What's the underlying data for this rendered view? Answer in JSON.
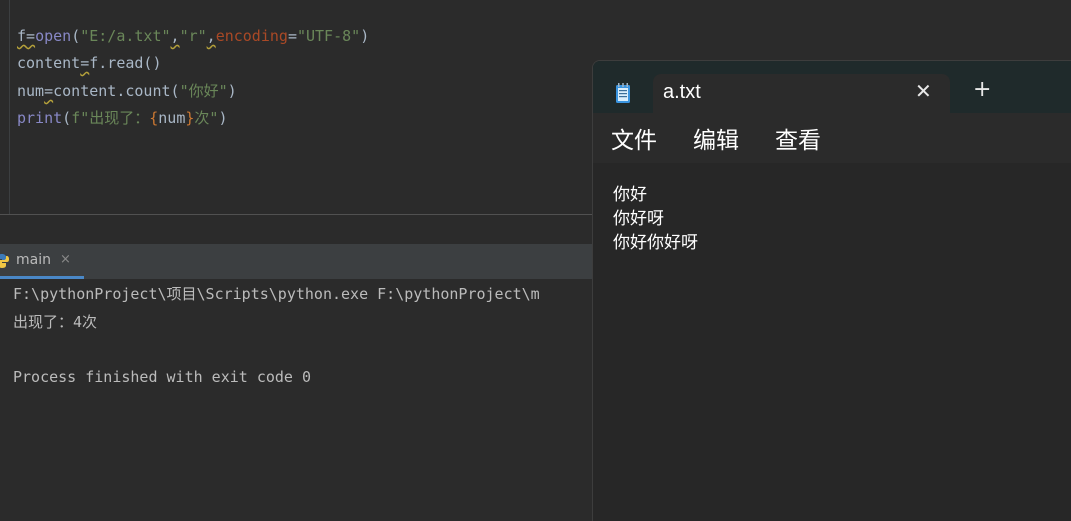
{
  "editor": {
    "lines": [
      {
        "p1": "f",
        "p2": "=",
        "p3": "open",
        "p4": "(",
        "p5": "\"E:/a.txt\"",
        "p6": ",",
        "p7": "\"r\"",
        "p8": ",",
        "p9": "encoding",
        "p10": "=",
        "p11": "\"UTF-8\"",
        "p12": ")"
      },
      {
        "p1": "content",
        "p2": "=",
        "p3": "f.read()"
      },
      {
        "p1": "num",
        "p2": "=",
        "p3": "content.count(",
        "p4": "\"你好\"",
        "p5": ")"
      },
      {
        "p1": "print",
        "p2": "(",
        "p3": "f\"出现了：",
        "p4": "{",
        "p5": "num",
        "p6": "}",
        "p7": "次\"",
        "p8": ")"
      }
    ]
  },
  "run_panel": {
    "tab_label": "main",
    "tab_close": "×",
    "console_lines": [
      "F:\\pythonProject\\项目\\Scripts\\python.exe F:\\pythonProject\\m",
      "出现了：4次",
      "",
      "Process finished with exit code 0"
    ]
  },
  "notepad": {
    "tab_title": "a.txt",
    "tab_close": "✕",
    "new_tab": "+",
    "menus": [
      "文件",
      "编辑",
      "查看"
    ],
    "content_lines": [
      "你好",
      "你好呀",
      "你好你好呀"
    ]
  },
  "colors": {
    "ide_bg": "#2b2b2b",
    "string": "#6a8759",
    "keyword_arg": "#aa4926",
    "builtin": "#8888c6",
    "tab_accent": "#4a88c7"
  }
}
